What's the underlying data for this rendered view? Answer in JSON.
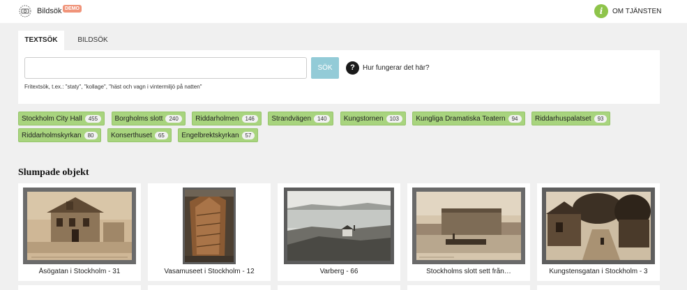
{
  "header": {
    "brand": "Bildsök",
    "badge": "DEMO",
    "about_icon": "i",
    "about_label": "OM TJÄNSTEN"
  },
  "tabs": [
    {
      "label": "TEXTSÖK",
      "active": true
    },
    {
      "label": "BILDSÖK",
      "active": false
    }
  ],
  "search": {
    "value": "",
    "placeholder": "",
    "button_label": "SÖK",
    "help_icon": "?",
    "help_label": "Hur fungerar det här?",
    "hint": "Fritextsök, t.ex.: \"staty\", \"kollage\", \"häst och vagn i vintermiljö på natten\""
  },
  "tags": [
    {
      "label": "Stockholm City Hall",
      "count": "455"
    },
    {
      "label": "Borgholms slott",
      "count": "240"
    },
    {
      "label": "Riddarholmen",
      "count": "146"
    },
    {
      "label": "Strandvägen",
      "count": "140"
    },
    {
      "label": "Kungstornen",
      "count": "103"
    },
    {
      "label": "Kungliga Dramatiska Teatern",
      "count": "94"
    },
    {
      "label": "Riddarhuspalatset",
      "count": "93"
    },
    {
      "label": "Riddarholmskyrkan",
      "count": "80"
    },
    {
      "label": "Konserthuset",
      "count": "65"
    },
    {
      "label": "Engelbrektskyrkan",
      "count": "57"
    }
  ],
  "section": {
    "title": "Slumpade objekt"
  },
  "cards": [
    {
      "caption": "Åsögatan i Stockholm - 31"
    },
    {
      "caption": "Vasamuseet i Stockholm - 12"
    },
    {
      "caption": "Varberg - 66"
    },
    {
      "caption": "Stockholms slott sett från…"
    },
    {
      "caption": "Kungstensgatan i Stockholm - 3"
    }
  ],
  "colors": {
    "accent_green": "#8ec44a",
    "tag_green": "#a8d47e",
    "search_button": "#93cbd7",
    "demo_badge": "#f0947a"
  }
}
